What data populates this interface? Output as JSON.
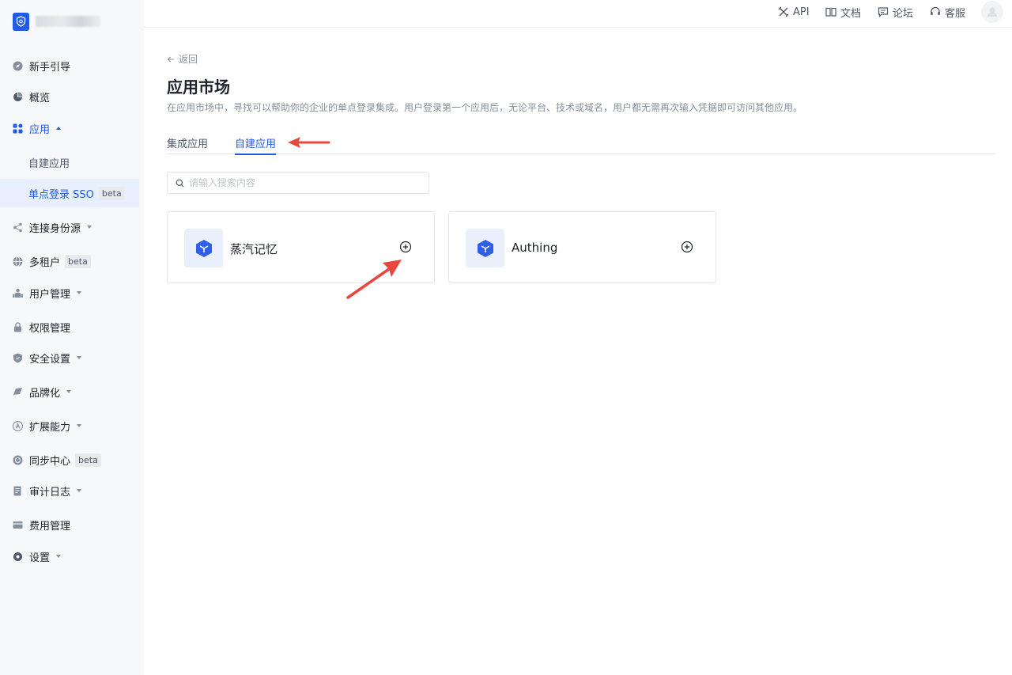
{
  "sidebar": {
    "items": [
      {
        "label": "新手引导",
        "icon": "compass-icon"
      },
      {
        "label": "概览",
        "icon": "pie-chart-icon"
      },
      {
        "label": "应用",
        "icon": "apps-icon"
      },
      {
        "label": "自建应用"
      },
      {
        "label": "单点登录 SSO",
        "badge": "beta"
      },
      {
        "label": "连接身份源",
        "icon": "share-icon"
      },
      {
        "label": "多租户",
        "icon": "globe-icon",
        "badge": "beta"
      },
      {
        "label": "用户管理",
        "icon": "users-icon"
      },
      {
        "label": "权限管理",
        "icon": "lock-icon"
      },
      {
        "label": "安全设置",
        "icon": "shield-icon"
      },
      {
        "label": "品牌化",
        "icon": "palette-icon"
      },
      {
        "label": "扩展能力",
        "icon": "extension-icon"
      },
      {
        "label": "同步中心",
        "icon": "sync-icon",
        "badge": "beta"
      },
      {
        "label": "审计日志",
        "icon": "log-icon"
      },
      {
        "label": "费用管理",
        "icon": "billing-icon"
      },
      {
        "label": "设置",
        "icon": "gear-icon"
      }
    ]
  },
  "header": {
    "links": [
      {
        "label": "API",
        "icon": "tools-icon"
      },
      {
        "label": "文档",
        "icon": "book-icon"
      },
      {
        "label": "论坛",
        "icon": "chat-icon"
      },
      {
        "label": "客服",
        "icon": "headset-icon"
      }
    ]
  },
  "main": {
    "back_label": "返回",
    "title": "应用市场",
    "description": "在应用市场中，寻找可以帮助你的企业的单点登录集成。用户登录第一个应用后，无论平台、技术或域名，用户都无需再次输入凭据即可访问其他应用。",
    "tabs": [
      {
        "label": "集成应用",
        "active": false
      },
      {
        "label": "自建应用",
        "active": true
      }
    ],
    "search": {
      "placeholder": "请输入搜索内容",
      "value": ""
    },
    "apps": [
      {
        "name": "蒸汽记忆",
        "icon": "cube-icon"
      },
      {
        "name": "Authing",
        "icon": "cube-icon"
      }
    ]
  },
  "colors": {
    "accent": "#215ae5",
    "annotation": "#e8473f",
    "sidebar_bg": "#f7f8fa",
    "selected_bg": "#e8f0ff"
  }
}
